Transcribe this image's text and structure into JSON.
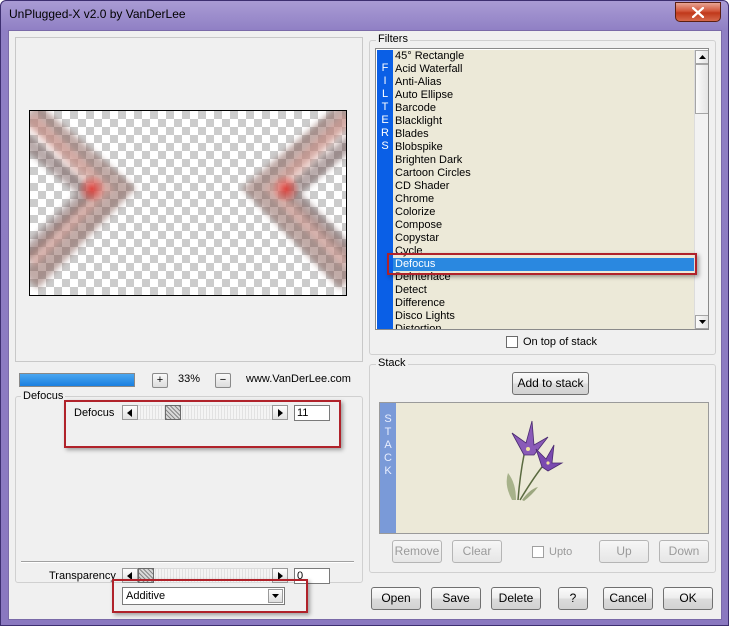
{
  "window": {
    "title": "UnPlugged-X v2.0 by VanDerLee"
  },
  "preview": {
    "progress_fraction": 1.0,
    "zoom_in_label": "+",
    "zoom_value": "33%",
    "zoom_out_label": "−",
    "website": "www.VanDerLee.com"
  },
  "settings": {
    "group_label": "Defocus",
    "defocus_label": "Defocus",
    "defocus_value": "11",
    "transparency_label": "Transparency",
    "transparency_value": "0",
    "blend_mode": "Additive"
  },
  "filters": {
    "group_label": "Filters",
    "sidebar_letters": [
      "F",
      "I",
      "L",
      "T",
      "E",
      "R",
      "S"
    ],
    "items": [
      "45° Rectangle",
      "Acid Waterfall",
      "Anti-Alias",
      "Auto Ellipse",
      "Barcode",
      "Blacklight",
      "Blades",
      "Blobspike",
      "Brighten Dark",
      "Cartoon Circles",
      "CD Shader",
      "Chrome",
      "Colorize",
      "Compose",
      "Copystar",
      "Cycle",
      "Defocus",
      "Deinterlace",
      "Detect",
      "Difference",
      "Disco Lights",
      "Distortion"
    ],
    "selected_index": 16,
    "on_top_label": "On top of stack"
  },
  "stack": {
    "group_label": "Stack",
    "add_label": "Add to stack",
    "sidebar_letters": [
      "S",
      "T",
      "A",
      "C",
      "K"
    ],
    "remove_label": "Remove",
    "clear_label": "Clear",
    "upto_label": "Upto",
    "up_label": "Up",
    "down_label": "Down"
  },
  "footer": {
    "open": "Open",
    "save": "Save",
    "delete": "Delete",
    "help": "?",
    "cancel": "Cancel",
    "ok": "OK"
  },
  "colors": {
    "accent": "#0a5fe6",
    "selection": "#2a88e0",
    "highlight_box": "#b0222a"
  }
}
